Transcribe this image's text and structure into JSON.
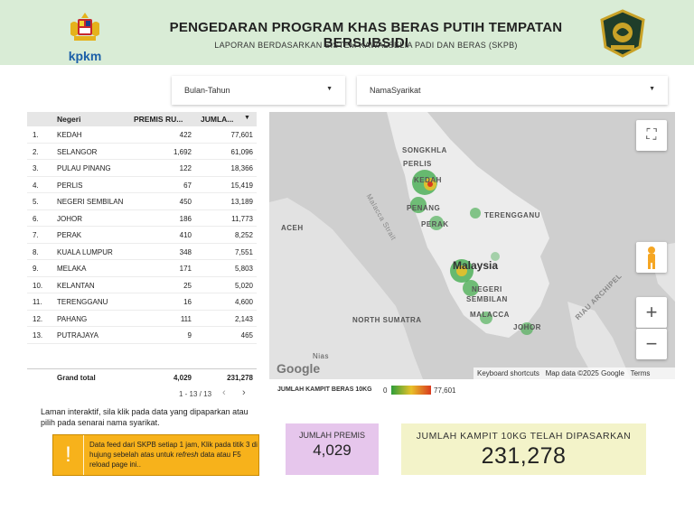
{
  "header": {
    "logo_text": "kpkm",
    "title": "PENGEDARAN PROGRAM KHAS BERAS PUTIH TEMPATAN BERSUBSIDI",
    "subtitle": "LAPORAN BERDASARKAN SISTEM KAWALSELIA PADI DAN BERAS (SKPB)"
  },
  "filters": {
    "date_label": "Bulan-Tahun",
    "company_label": "NamaSyarikat"
  },
  "table": {
    "headers": {
      "name": "Negeri",
      "premis": "PREMIS RU...",
      "jumlah": "JUMLA...",
      "sort_icon": "▼"
    },
    "rows": [
      {
        "idx": "1.",
        "name": "KEDAH",
        "premis": "422",
        "jumlah": "77,601"
      },
      {
        "idx": "2.",
        "name": "SELANGOR",
        "premis": "1,692",
        "jumlah": "61,096"
      },
      {
        "idx": "3.",
        "name": "PULAU PINANG",
        "premis": "122",
        "jumlah": "18,366"
      },
      {
        "idx": "4.",
        "name": "PERLIS",
        "premis": "67",
        "jumlah": "15,419"
      },
      {
        "idx": "5.",
        "name": "NEGERI SEMBILAN",
        "premis": "450",
        "jumlah": "13,189"
      },
      {
        "idx": "6.",
        "name": "JOHOR",
        "premis": "186",
        "jumlah": "11,773"
      },
      {
        "idx": "7.",
        "name": "PERAK",
        "premis": "410",
        "jumlah": "8,252"
      },
      {
        "idx": "8.",
        "name": "KUALA LUMPUR",
        "premis": "348",
        "jumlah": "7,551"
      },
      {
        "idx": "9.",
        "name": "MELAKA",
        "premis": "171",
        "jumlah": "5,803"
      },
      {
        "idx": "10.",
        "name": "KELANTAN",
        "premis": "25",
        "jumlah": "5,020"
      },
      {
        "idx": "11.",
        "name": "TERENGGANU",
        "premis": "16",
        "jumlah": "4,600"
      },
      {
        "idx": "12.",
        "name": "PAHANG",
        "premis": "111",
        "jumlah": "2,143"
      },
      {
        "idx": "13.",
        "name": "PUTRAJAYA",
        "premis": "9",
        "jumlah": "465"
      }
    ],
    "total": {
      "label": "Grand total",
      "premis": "4,029",
      "jumlah": "231,278"
    },
    "pager": "1 - 13 / 13"
  },
  "map": {
    "labels": {
      "songkhla": "SONGKHLA",
      "perlis": "PERLIS",
      "kedah": "KEDAH",
      "penang": "PENANG",
      "perak": "PERAK",
      "terengganu": "TERENGGANU",
      "aceh": "ACEH",
      "malaysia": "Malaysia",
      "negeri_sembilan_1": "NEGERI",
      "negeri_sembilan_2": "SEMBILAN",
      "malacca": "MALACCA",
      "johor": "JOHOR",
      "north_sumatra": "NORTH SUMATRA",
      "nias": "Nias",
      "strait": "Malacca Strait",
      "riau": "RIAU ARCHIPEL"
    },
    "google_logo": "Google",
    "attribution": {
      "shortcuts": "Keyboard shortcuts",
      "map_data": "Map data ©2025 Google",
      "terms": "Terms"
    },
    "icons": {
      "fullscreen": "fullscreen-icon",
      "pegman": "pegman-icon",
      "zoom_in": "+",
      "zoom_out": "−"
    }
  },
  "legend": {
    "label": "JUMLAH KAMPIT BERAS 10KG",
    "min": "0",
    "max": "77,601",
    "colors": [
      "#2e9e3a",
      "#e8c12a",
      "#d93a1f"
    ]
  },
  "info": {
    "text": "Laman interaktif, sila klik pada data yang dipaparkan atau pilih pada senarai nama syarikat.",
    "notice_icon": "!",
    "notice_part1": "Data feed dari SKPB setiap 1 jam, Klik pada titik 3 di hujung sebelah atas untuk ",
    "notice_em": "refresh",
    "notice_part2": " data atau F5 reload page ini.."
  },
  "kpi": {
    "premis_label": "JUMLAH PREMIS",
    "premis_value": "4,029",
    "kampit_label": "JUMLAH KAMPIT 10KG TELAH DIPASARKAN",
    "kampit_value": "231,278"
  },
  "colors": {
    "header_bg": "#d9ecd6",
    "notice_bg": "#f7b21b",
    "kpi_premis_bg": "#e6c6ec",
    "kpi_kampit_bg": "#f3f3c9"
  }
}
